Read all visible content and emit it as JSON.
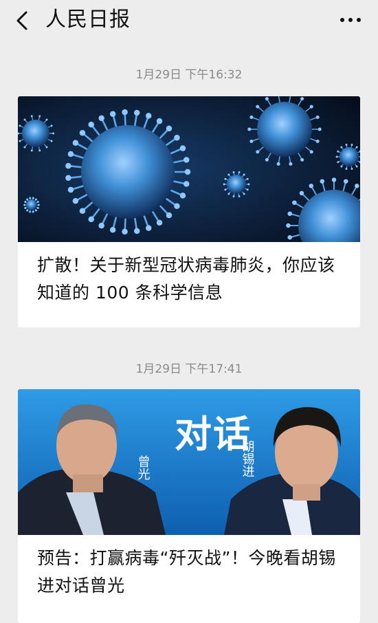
{
  "header": {
    "title": "人民日报"
  },
  "messages": [
    {
      "time": "1月29日 下午16:32",
      "title": "扩散！关于新型冠状病毒肺炎，你应该知道的 100 条科学信息"
    },
    {
      "time": "1月29日 下午17:41",
      "title": "预告：打赢病毒“歼灭战”！今晚看胡锡进对话曾光",
      "banner_main": "对话",
      "banner_left": "曾光",
      "banner_right": "胡锡进"
    }
  ],
  "colors": {
    "background": "#ededed",
    "card": "#ffffff",
    "timestamp": "#8a8a8a",
    "virus_bg": "#081226",
    "virus_blue": "#3f8fd6",
    "banner_blue": "#1f7fd0"
  },
  "icons": {
    "back": "chevron-left-icon",
    "more": "more-dots-icon"
  }
}
